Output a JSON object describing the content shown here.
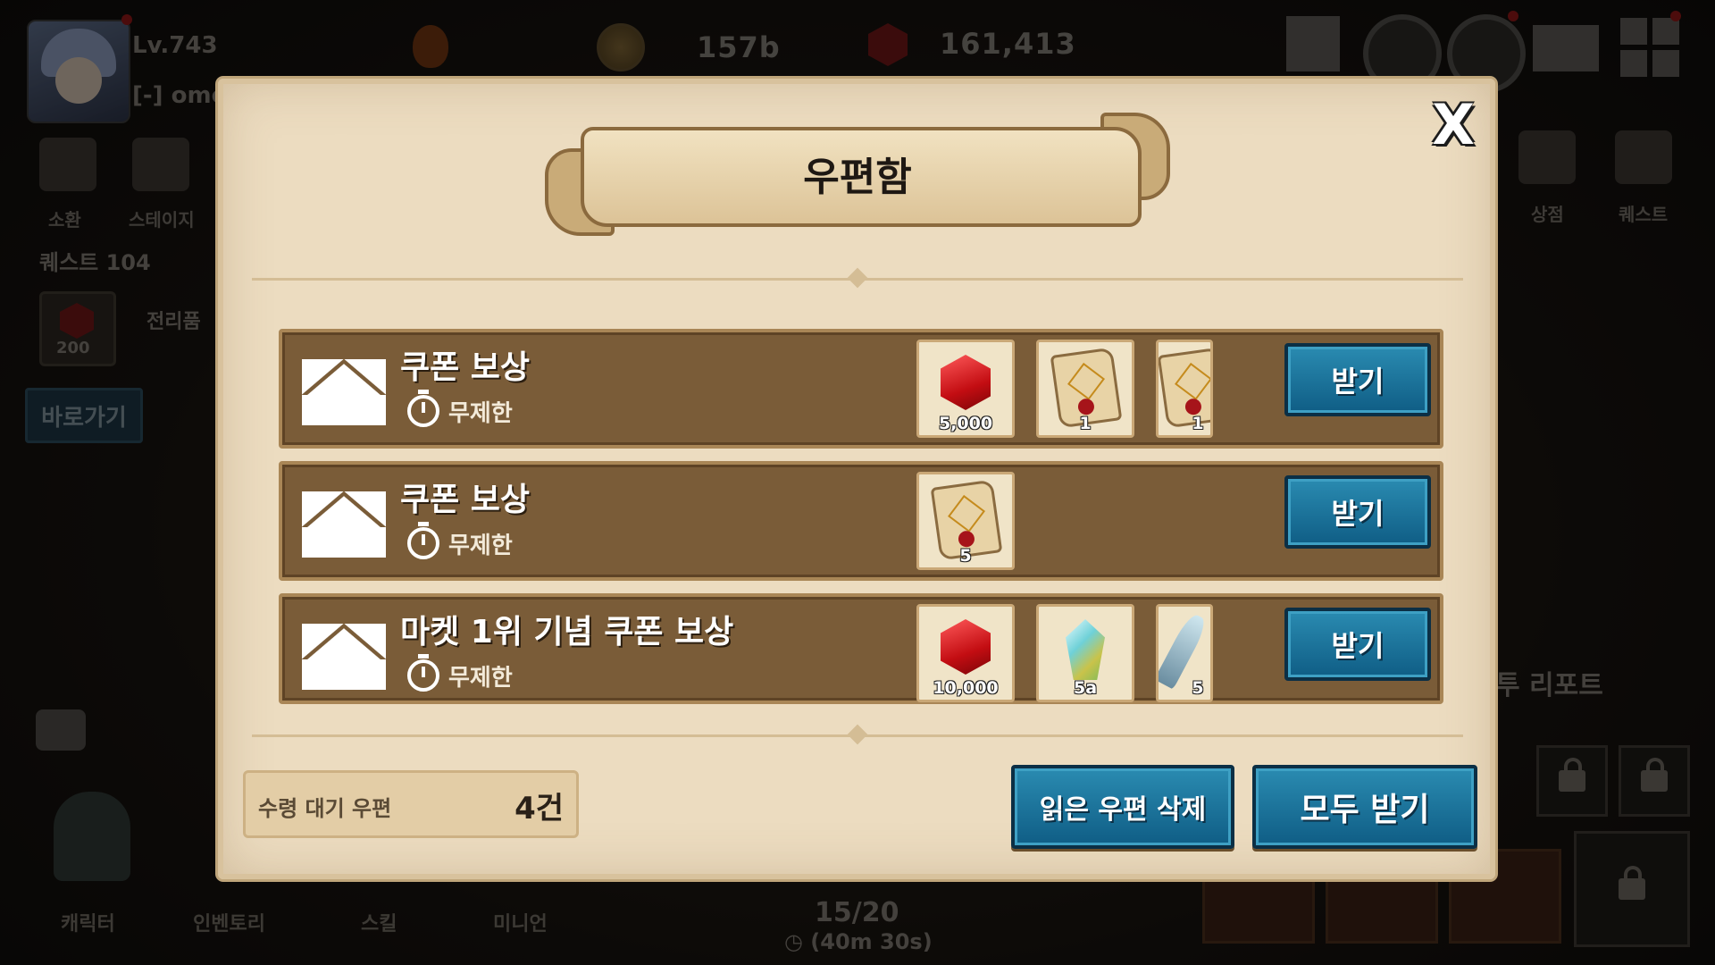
{
  "hud": {
    "level": "Lv.743",
    "guild": "[-] omo",
    "gold": "157b",
    "gems": "161,413"
  },
  "left_menu": {
    "summon": "소환",
    "stage": "스테이지",
    "quest": "퀘스트 104",
    "loot": "전리품 ",
    "loot_count": "200",
    "goto": "바로가기"
  },
  "right_menu": {
    "shop": "상점",
    "quest": "퀘스트",
    "report": "투 리포트"
  },
  "bottom_nav": {
    "character": "캐릭터",
    "inventory": "인벤토리",
    "skill": "스킬",
    "minion": "미니언",
    "progress": "15/20",
    "timer": "(40m 30s)"
  },
  "mailbox": {
    "title": "우편함",
    "close": "X",
    "mails": [
      {
        "title": "쿠폰 보상",
        "limit": "무제한",
        "rewards": [
          {
            "icon": "ruby-icon",
            "qty": "5,000"
          },
          {
            "icon": "scroll-icon",
            "qty": "1"
          },
          {
            "icon": "scroll-icon",
            "qty": "1"
          }
        ],
        "claim": "받기"
      },
      {
        "title": "쿠폰 보상",
        "limit": "무제한",
        "rewards": [
          {
            "icon": "scroll-icon",
            "qty": "5"
          }
        ],
        "claim": "받기"
      },
      {
        "title": "마켓 1위 기념 쿠폰 보상",
        "limit": "무제한",
        "rewards": [
          {
            "icon": "ruby-icon",
            "qty": "10,000"
          },
          {
            "icon": "crystal-icon",
            "qty": "5a"
          },
          {
            "icon": "quill-icon",
            "qty": "5"
          }
        ],
        "claim": "받기"
      }
    ],
    "pending_label": "수령 대기 우편",
    "pending_count": "4건",
    "delete_read": "읽은 우편 삭제",
    "claim_all": "모두 받기"
  },
  "colors": {
    "panel": "#ecdcc0",
    "row": "#7a5c38",
    "button": "#0f5d85",
    "ruby": "#c30d12"
  }
}
